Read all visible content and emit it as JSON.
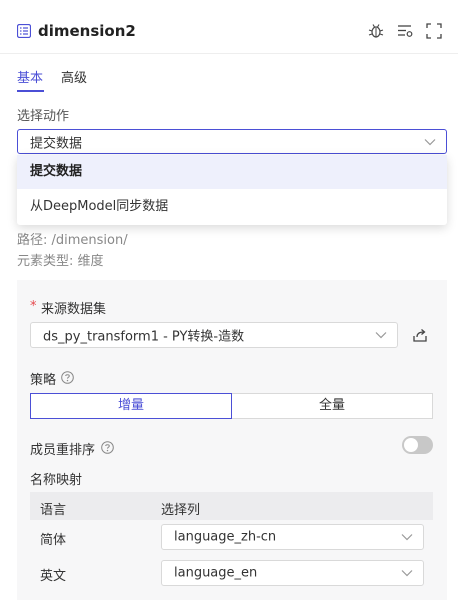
{
  "header": {
    "title": "dimension2"
  },
  "tabs": [
    {
      "label": "基本",
      "active": true
    },
    {
      "label": "高级",
      "active": false
    }
  ],
  "action": {
    "label": "选择动作",
    "value": "提交数据",
    "options": [
      "提交数据",
      "从DeepModel同步数据"
    ],
    "selected_index": 0
  },
  "info": {
    "path": "路径: /dimension/",
    "type": "元素类型: 维度"
  },
  "source": {
    "required_mark": "*",
    "label": "来源数据集",
    "value": "ds_py_transform1 - PY转换-造数"
  },
  "strategy": {
    "label": "策略",
    "options": [
      "增量",
      "全量"
    ],
    "active_index": 0
  },
  "reorder": {
    "label": "成员重排序",
    "enabled": false
  },
  "mapping": {
    "label": "名称映射",
    "headers": [
      "语言",
      "选择列"
    ],
    "rows": [
      {
        "lang": "简体",
        "column": "language_zh-cn"
      },
      {
        "lang": "英文",
        "column": "language_en"
      }
    ]
  },
  "colors": {
    "accent": "#4b4fd6",
    "required": "#e5484d",
    "panel_bg": "#f7f7f8"
  }
}
